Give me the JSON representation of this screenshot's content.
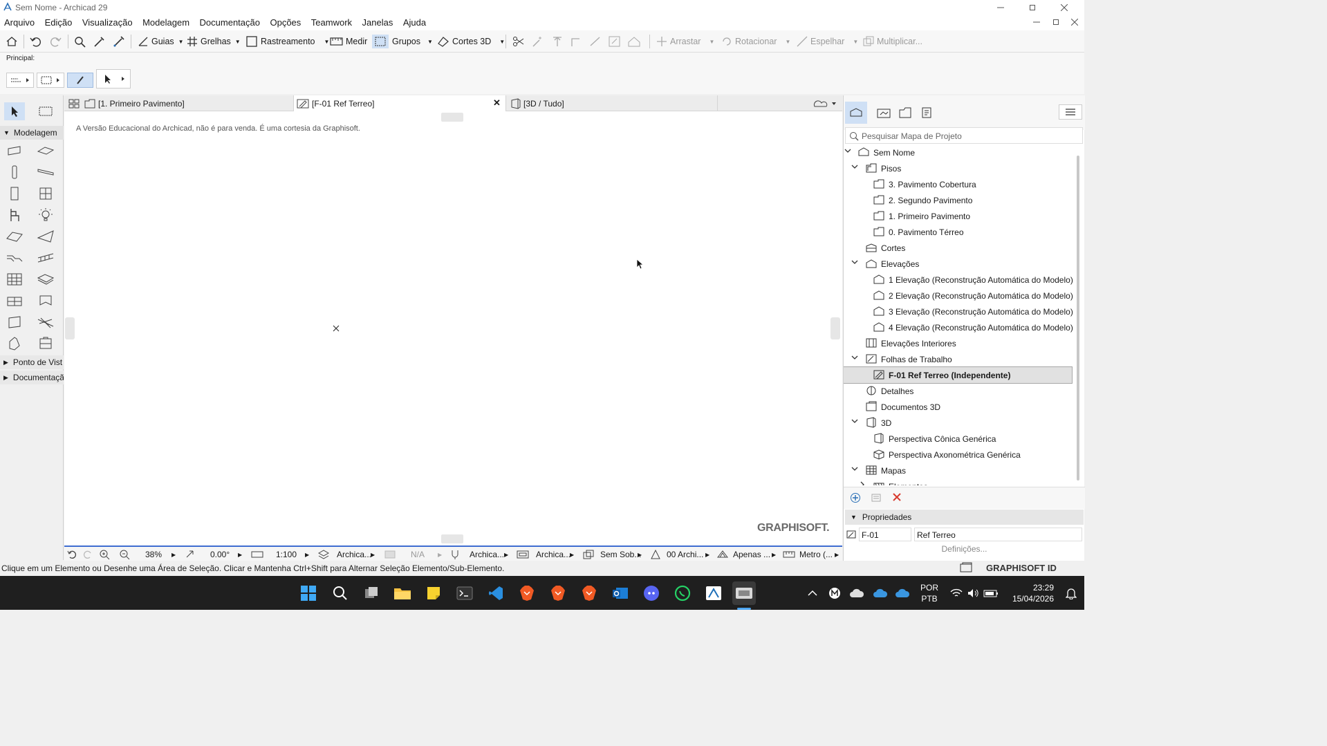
{
  "window": {
    "title": "Sem Nome - Archicad 29"
  },
  "menubar": {
    "items": [
      "Arquivo",
      "Edição",
      "Visualização",
      "Modelagem",
      "Documentação",
      "Opções",
      "Teamwork",
      "Janelas",
      "Ajuda"
    ]
  },
  "toolbar": {
    "guias": "Guias",
    "grelhas": "Grelhas",
    "rastreamento": "Rastreamento",
    "medir": "Medir",
    "grupos": "Grupos",
    "cortes3d": "Cortes 3D",
    "arrastar": "Arrastar",
    "rotacionar": "Rotacionar",
    "espelhar": "Espelhar",
    "multiplicar": "Multiplicar..."
  },
  "principal": {
    "label": "Principal:"
  },
  "toolbox": {
    "modelagem": "Modelagem",
    "ponto_de_vista": "Ponto de Vist",
    "documentacao": "Documentaçã"
  },
  "tabs": [
    {
      "label": "[1. Primeiro Pavimento]"
    },
    {
      "label": "[F-01 Ref Terreo]"
    },
    {
      "label": "[3D / Tudo]"
    }
  ],
  "canvas": {
    "notice": "A Versão Educacional do Archicad, não é para venda. É uma cortesia da Graphisoft.",
    "watermark": "GRAPHISOFT."
  },
  "statusbar": {
    "zoom": "38%",
    "angle": "0.00°",
    "scale": "1:100",
    "layer": "Archica...",
    "na": "N/A",
    "pen": "Archica...",
    "model_view": "Archica...",
    "override": "Sem Sob...",
    "renovation": "00 Archi...",
    "structure": "Apenas ...",
    "units": "Metro (..."
  },
  "hint": "Clique em um Elemento ou Desenhe uma Área de Seleção. Clicar e Mantenha Ctrl+Shift para Alternar Seleção Elemento/Sub-Elemento.",
  "navigator": {
    "search_placeholder": "Pesquisar Mapa de Projeto",
    "tree": [
      {
        "label": "Sem Nome",
        "level": 0,
        "chev": "v",
        "icon": "project-icon"
      },
      {
        "label": "Pisos",
        "level": 1,
        "chev": "v",
        "icon": "story-folder-icon"
      },
      {
        "label": "3. Pavimento Cobertura",
        "level": 2,
        "chev": "",
        "icon": "story-icon"
      },
      {
        "label": "2. Segundo Pavimento",
        "level": 2,
        "chev": "",
        "icon": "story-icon"
      },
      {
        "label": "1. Primeiro Pavimento",
        "level": 2,
        "chev": "",
        "icon": "story-icon"
      },
      {
        "label": "0. Pavimento Térreo",
        "level": 2,
        "chev": "",
        "icon": "story-icon"
      },
      {
        "label": "Cortes",
        "level": 1,
        "chev": "",
        "icon": "section-icon"
      },
      {
        "label": "Elevações",
        "level": 1,
        "chev": "v",
        "icon": "elevation-folder-icon"
      },
      {
        "label": "1 Elevação (Reconstrução Automática do Modelo)",
        "level": 2,
        "chev": "",
        "icon": "elevation-icon"
      },
      {
        "label": "2 Elevação (Reconstrução Automática do Modelo)",
        "level": 2,
        "chev": "",
        "icon": "elevation-icon"
      },
      {
        "label": "3 Elevação (Reconstrução Automática do Modelo)",
        "level": 2,
        "chev": "",
        "icon": "elevation-icon"
      },
      {
        "label": "4 Elevação (Reconstrução Automática do Modelo)",
        "level": 2,
        "chev": "",
        "icon": "elevation-icon"
      },
      {
        "label": "Elevações Interiores",
        "level": 1,
        "chev": "",
        "icon": "interior-elevation-icon"
      },
      {
        "label": "Folhas de Trabalho",
        "level": 1,
        "chev": "v",
        "icon": "worksheet-folder-icon"
      },
      {
        "label": "F-01 Ref Terreo (Independente)",
        "level": 2,
        "chev": "",
        "icon": "worksheet-icon",
        "selected": true
      },
      {
        "label": "Detalhes",
        "level": 1,
        "chev": "",
        "icon": "detail-icon"
      },
      {
        "label": "Documentos 3D",
        "level": 1,
        "chev": "",
        "icon": "document-3d-icon"
      },
      {
        "label": "3D",
        "level": 1,
        "chev": "v",
        "icon": "3d-folder-icon"
      },
      {
        "label": "Perspectiva Cônica Genérica",
        "level": 2,
        "chev": "",
        "icon": "perspective-icon"
      },
      {
        "label": "Perspectiva Axonométrica Genérica",
        "level": 2,
        "chev": "",
        "icon": "axonometry-icon"
      },
      {
        "label": "Mapas",
        "level": 1,
        "chev": "v",
        "icon": "schedule-folder-icon"
      },
      {
        "label": "Elementos",
        "level": 2,
        "chev": ">",
        "icon": "schedule-icon"
      }
    ],
    "properties_label": "Propriedades",
    "prop_id": "F-01",
    "prop_name": "Ref Terreo",
    "definicoes": "Definições...",
    "graphisoft_id": "GRAPHISOFT ID"
  },
  "taskbar": {
    "lang1": "POR",
    "lang2": "PTB",
    "time": "23:29",
    "date": "15/04/2026"
  },
  "colors": {
    "accent": "#3e6cd1",
    "selection_bg": "#e1e1e1",
    "taskbar": "#1f1f1f",
    "delete_red": "#d83b2f"
  }
}
